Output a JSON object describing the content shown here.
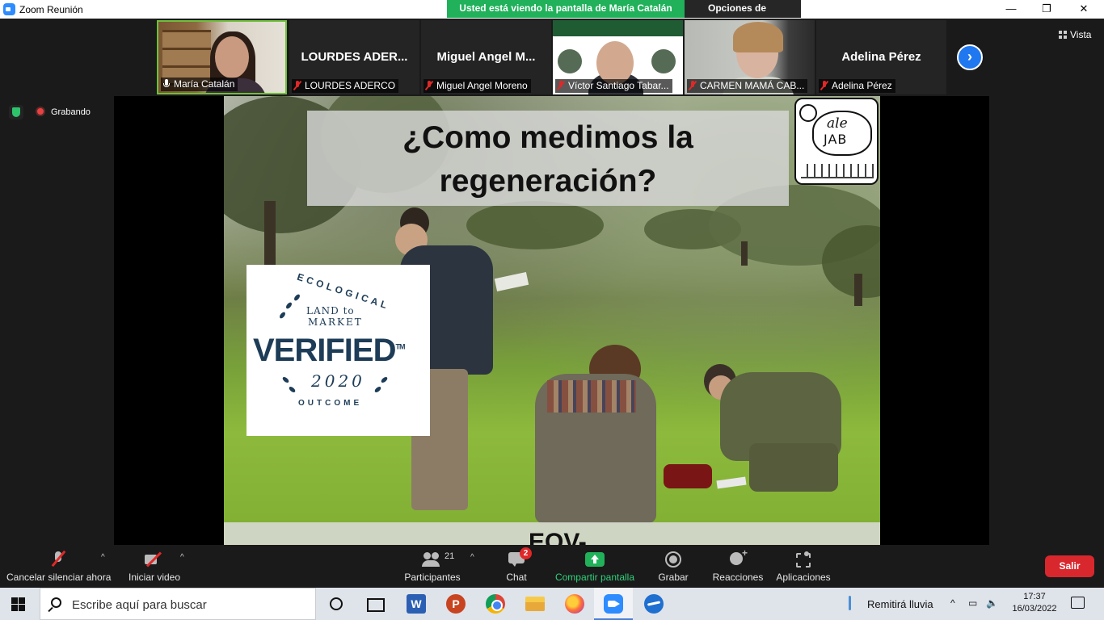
{
  "window": {
    "title": "Zoom Reunión",
    "minimize": "—",
    "maximize": "❐",
    "close": "✕"
  },
  "share_banner": {
    "text": "Usted está viendo la pantalla de María Catalán",
    "view_options": "Opciones de vista",
    "chevron": "⌄"
  },
  "participants_strip": [
    {
      "name": "María Catalán",
      "big_name": "",
      "mic": "on",
      "video": "maria"
    },
    {
      "name": "LOURDES ADERCO",
      "big_name": "LOURDES ADER...",
      "mic": "off",
      "video": ""
    },
    {
      "name": "Miguel Angel Moreno",
      "big_name": "Miguel Angel M...",
      "mic": "off",
      "video": ""
    },
    {
      "name": "Víctor Santiago Tabar...",
      "big_name": "",
      "mic": "off",
      "video": "victor"
    },
    {
      "name": "CARMEN MAMÁ CAB...",
      "big_name": "",
      "mic": "off",
      "video": "carmen"
    },
    {
      "name": "Adelina Pérez",
      "big_name": "Adelina Pérez",
      "mic": "off",
      "video": ""
    }
  ],
  "strip_next": "›",
  "view_button": "Vista",
  "recording": {
    "label": "Grabando"
  },
  "slide": {
    "title_line1": "¿Como medimos la",
    "title_line2": "regeneración?",
    "logo_line1": "ale",
    "logo_line2": "JAB",
    "badge": {
      "top": "ECOLOGICAL",
      "land": "LAND to",
      "market": "MARKET",
      "verified": "VERIFIED",
      "tm": "TM",
      "year": "2020",
      "bottom": "OUTCOME"
    },
    "footer_text": "EOV-"
  },
  "toolbar": {
    "mute": "Cancelar silenciar ahora",
    "video": "Iniciar video",
    "participants": "Participantes",
    "participants_count": "21",
    "chat": "Chat",
    "chat_badge": "2",
    "share": "Compartir pantalla",
    "record": "Grabar",
    "reactions": "Reacciones",
    "apps": "Aplicaciones",
    "leave": "Salir",
    "caret": "^"
  },
  "taskbar": {
    "search_placeholder": "Escribe aquí para buscar",
    "word_letter": "W",
    "ppt_letter": "P",
    "weather": "Remitirá lluvia",
    "tray_chevron": "^",
    "tray_net": "▭",
    "tray_sound": "🔈",
    "time": "17:37",
    "date": "16/03/2022"
  },
  "colors": {
    "share_green": "#20b15a",
    "leave_red": "#d9272e",
    "zoom_blue": "#2d8cff",
    "badge_navy": "#1d3c57"
  }
}
